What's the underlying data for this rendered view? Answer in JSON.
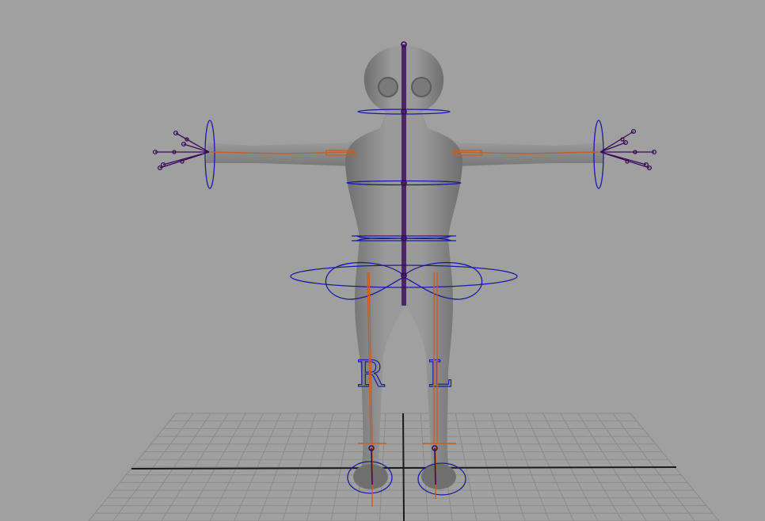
{
  "viewport": {
    "colors": {
      "background": "#a0a0a0",
      "grid_line": "#8a8a8a",
      "grid_axis": "#1a1a1a",
      "mesh_body": "#8d8d8d",
      "mesh_shadow": "#6f6f6f",
      "joint": "#3a0a5a",
      "bone": "#c0602a",
      "control_curve": "#1a1aa0"
    }
  },
  "labels": {
    "right_leg": "R",
    "left_leg": "L"
  }
}
